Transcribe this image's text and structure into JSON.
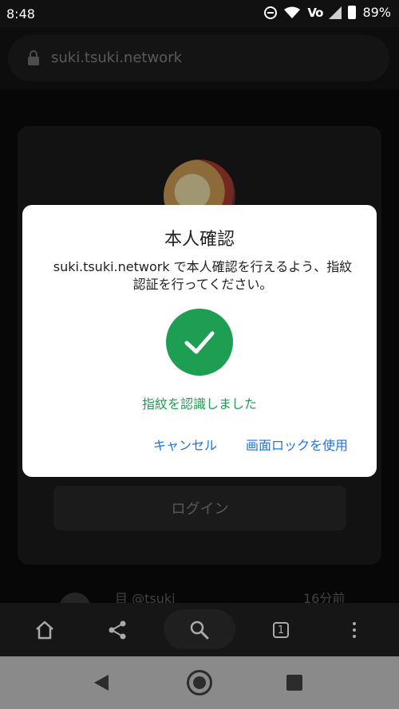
{
  "status_bar": {
    "time": "8:48",
    "network": "Vo",
    "battery": "89%"
  },
  "browser": {
    "url": "suki.tsuki.network",
    "tab_count": "1"
  },
  "page": {
    "login_label": "ログイン",
    "feed_name": "目 @tsuki",
    "feed_time": "16分前"
  },
  "dialog": {
    "title": "本人確認",
    "body": "suki.tsuki.network で本人確認を行えるよう、指紋認証を行ってください。",
    "status": "指紋を認識しました",
    "cancel_label": "キャンセル",
    "screen_lock_label": "画面ロックを使用"
  },
  "colors": {
    "success": "#1e9e52",
    "link": "#1a73e8"
  },
  "icons": [
    "lock-icon",
    "home-icon",
    "share-icon",
    "search-icon",
    "tabs-icon",
    "more-icon",
    "check-icon",
    "back-icon",
    "nav-home-icon",
    "recents-icon"
  ]
}
